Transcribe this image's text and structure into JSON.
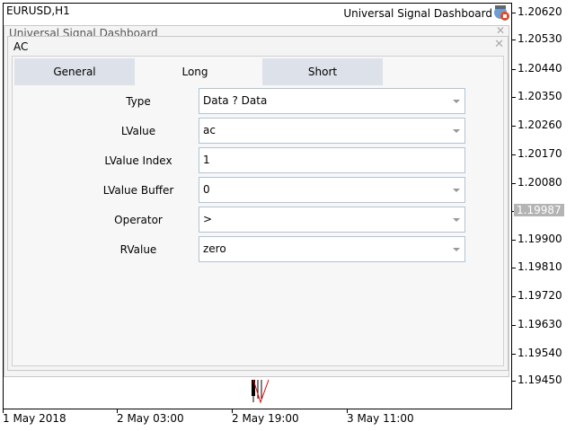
{
  "chart": {
    "symbol": "EURUSD,H1",
    "indicator": "Universal Signal Dashboard",
    "current_price": "1.19987",
    "prices": [
      "1.20620",
      "1.20530",
      "1.20440",
      "1.20350",
      "1.20260",
      "1.20170",
      "1.20080",
      "1.19900",
      "1.19810",
      "1.19720",
      "1.19630",
      "1.19540",
      "1.19450"
    ],
    "times": [
      "1 May 2018",
      "2 May 03:00",
      "2 May 19:00",
      "3 May 11:00"
    ]
  },
  "outer_dialog": {
    "title": "Universal Signal Dashboard"
  },
  "dialog": {
    "title": "AC",
    "tabs": [
      "General",
      "Long",
      "Short"
    ],
    "active_tab": "Long",
    "rows": [
      {
        "label": "Type",
        "value": "Data ? Data",
        "dropdown": true
      },
      {
        "label": "LValue",
        "value": "ac",
        "dropdown": true
      },
      {
        "label": "LValue Index",
        "value": "1",
        "dropdown": false
      },
      {
        "label": "LValue Buffer",
        "value": "0",
        "dropdown": true
      },
      {
        "label": "Operator",
        "value": ">",
        "dropdown": true
      },
      {
        "label": "RValue",
        "value": "zero",
        "dropdown": true
      }
    ]
  }
}
